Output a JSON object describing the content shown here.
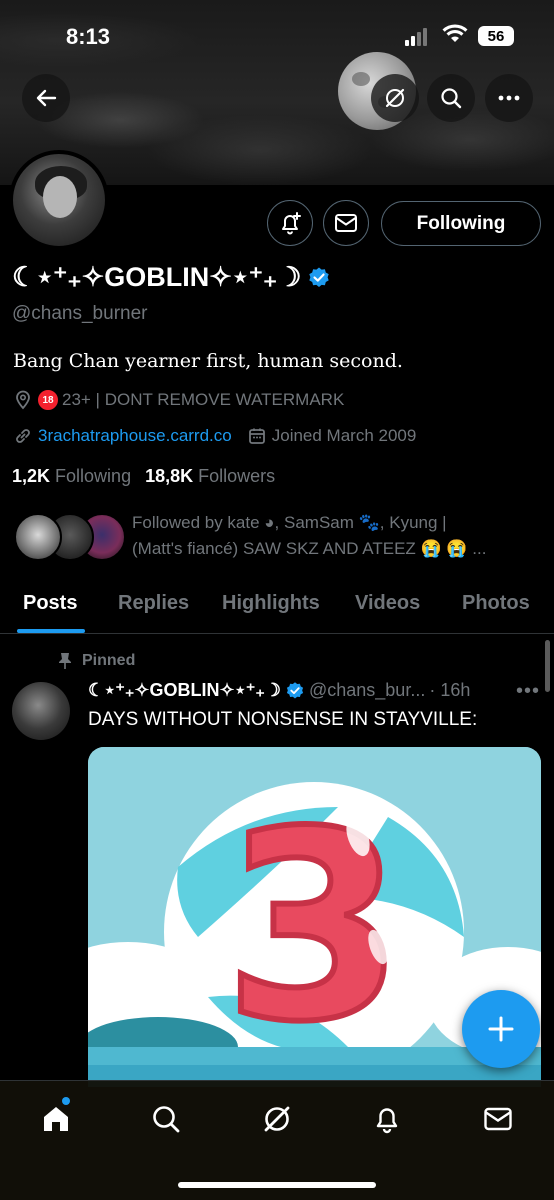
{
  "status_bar": {
    "time": "8:13",
    "battery": "56"
  },
  "profile": {
    "name": "☾⋆⁺₊✧GOBLIN✧⋆⁺₊☽",
    "handle": "@chans_burner",
    "bio": "Bang Chan yearner first, human second.",
    "location_badge": "18",
    "location": "23+ | DONT REMOVE WATERMARK",
    "website": "3rachatraphouse.carrd.co",
    "joined": "Joined March 2009",
    "following_count": "1,2K",
    "following_label": "Following",
    "followers_count": "18,8K",
    "followers_label": "Followers",
    "followed_by_line1": "Followed by kate ◕, SamSam 🐾, Kyung |",
    "followed_by_line2": "(Matt's fiancé) SAW SKZ AND ATEEZ 😭 😭 ...",
    "follow_button": "Following"
  },
  "tabs": [
    {
      "label": "Posts",
      "active": true
    },
    {
      "label": "Replies"
    },
    {
      "label": "Highlights"
    },
    {
      "label": "Videos"
    },
    {
      "label": "Photos"
    }
  ],
  "post": {
    "pinned_label": "Pinned",
    "author_name": "☾⋆⁺₊✧GOBLIN✧⋆⁺₊☽",
    "author_handle": "@chans_bur...",
    "time": "· 16h",
    "text": "DAYS WITHOUT NONSENSE IN STAYVILLE:",
    "image_number": "3"
  },
  "colors": {
    "accent": "#1d9bf0",
    "background": "#000000",
    "muted": "#71767b",
    "image_red": "#e84a5f",
    "image_sky": "#8fd3df"
  },
  "icons": [
    "back-icon",
    "grok-icon",
    "search-icon",
    "more-icon",
    "notification-add-icon",
    "mail-icon",
    "location-icon",
    "link-icon",
    "calendar-icon",
    "pin-icon",
    "home-icon",
    "plus-icon",
    "bell-icon"
  ]
}
